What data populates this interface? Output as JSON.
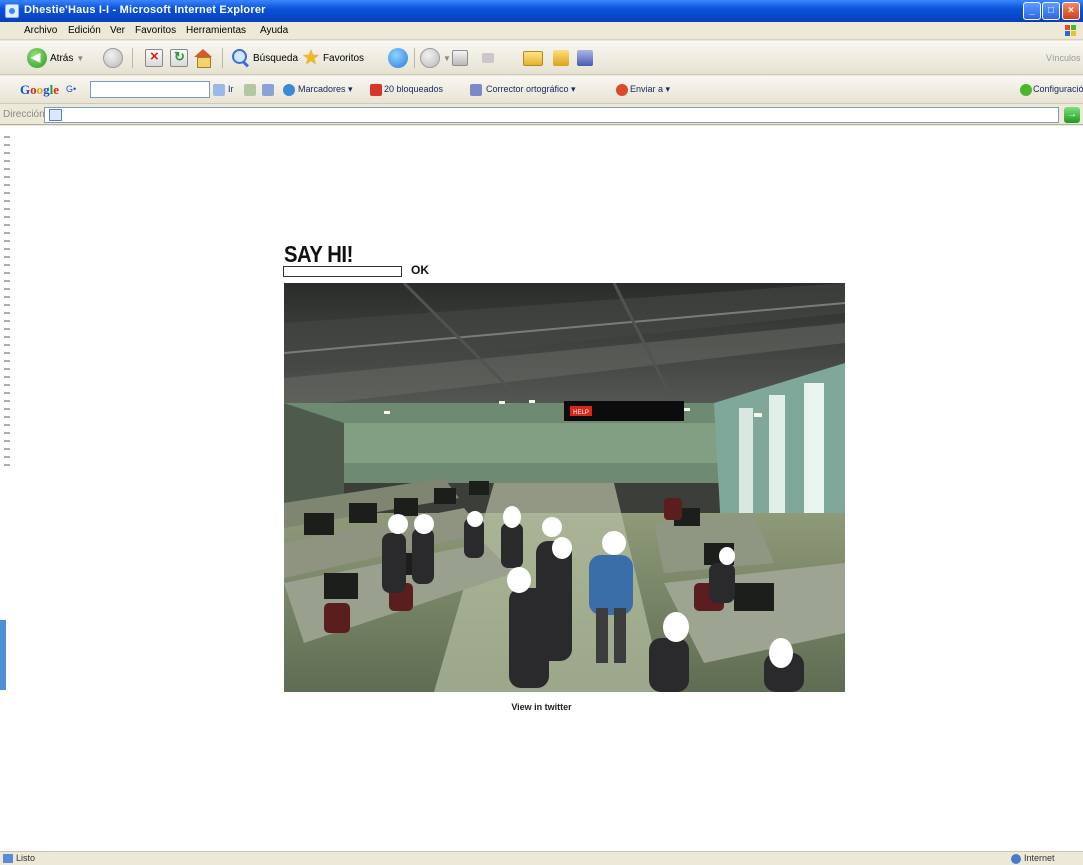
{
  "window": {
    "title": "Dhestie'Haus I-I - Microsoft Internet Explorer",
    "controls": {
      "minimize": "_",
      "maximize": "□",
      "close": "×"
    }
  },
  "menu": [
    "Archivo",
    "Edición",
    "Ver",
    "Favoritos",
    "Herramientas",
    "Ayuda"
  ],
  "toolbar": {
    "back_label": "Atrás",
    "search_label": "Búsqueda",
    "favorites_label": "Favoritos",
    "right_label": "Vínculos"
  },
  "google_bar": {
    "logo": [
      "G",
      "o",
      "o",
      "g",
      "l",
      "e"
    ],
    "search_prefix": "G•",
    "go_label": "Ir",
    "bookmarks_label": "Marcadores ▾",
    "blocked_label": "20 bloqueados",
    "spellcheck_label": "Corrector ortográfico ▾",
    "send_label": "Enviar a ▾",
    "settings_label": "Configuración ▾"
  },
  "address": {
    "label": "Dirección",
    "value": ""
  },
  "page": {
    "heading": "SAY HI!",
    "input_value": "",
    "ok_label": "OK",
    "twitter_link": "View in twitter",
    "feed_sign": "HELP"
  },
  "status": {
    "left": "Listo",
    "right": "Internet"
  },
  "colors": {
    "title_bar": "#0a52d8",
    "chrome": "#ece9d8",
    "page_background": "#ffffff"
  }
}
